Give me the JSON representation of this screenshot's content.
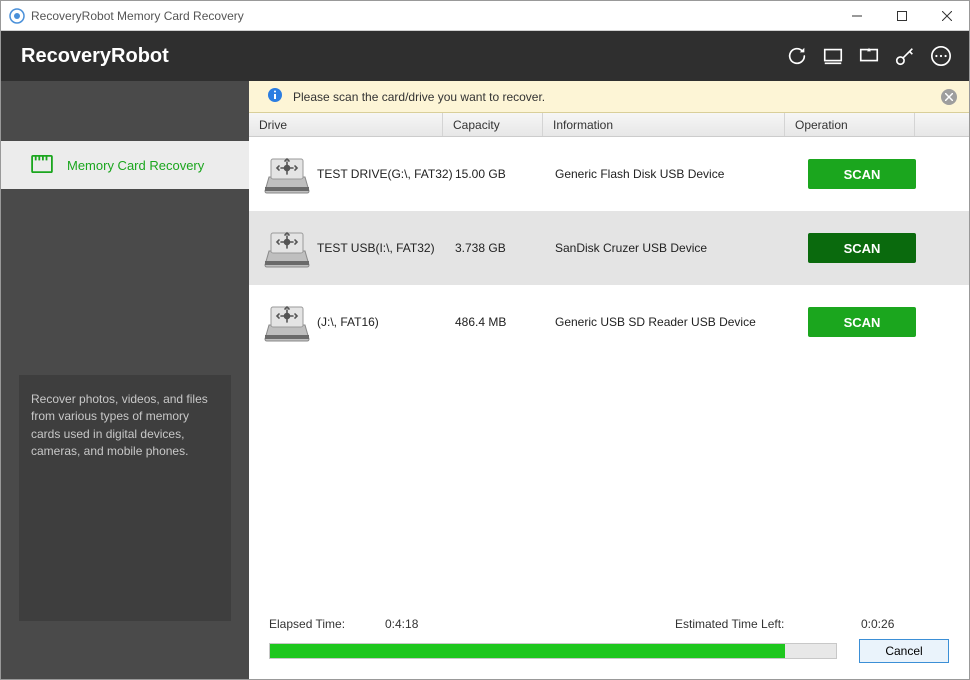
{
  "window": {
    "title": "RecoveryRobot Memory Card Recovery"
  },
  "header": {
    "brand": "RecoveryRobot"
  },
  "sidebar": {
    "active_item": "Memory Card Recovery",
    "description": "Recover photos, videos, and files from various types of memory cards used in digital devices, cameras, and mobile phones."
  },
  "infostrip": {
    "text": "Please scan the card/drive you want to recover."
  },
  "table": {
    "headers": {
      "drive": "Drive",
      "capacity": "Capacity",
      "information": "Information",
      "operation": "Operation"
    },
    "rows": [
      {
        "name": "TEST DRIVE(G:\\, FAT32)",
        "capacity": "15.00 GB",
        "info": "Generic  Flash Disk  USB Device",
        "button": "SCAN",
        "selected": false
      },
      {
        "name": "TEST USB(I:\\, FAT32)",
        "capacity": "3.738 GB",
        "info": "SanDisk  Cruzer  USB Device",
        "button": "SCAN",
        "selected": true
      },
      {
        "name": "(J:\\, FAT16)",
        "capacity": "486.4 MB",
        "info": "Generic  USB SD Reader  USB Device",
        "button": "SCAN",
        "selected": false
      }
    ]
  },
  "footer": {
    "elapsed_label": "Elapsed Time:",
    "elapsed_value": "0:4:18",
    "eta_label": "Estimated Time Left:",
    "eta_value": "0:0:26",
    "progress_percent": 91,
    "cancel": "Cancel"
  },
  "colors": {
    "accent_green": "#1ba61e",
    "header_bg": "#2f2f2f",
    "sidebar_bg": "#4a4a4a"
  }
}
